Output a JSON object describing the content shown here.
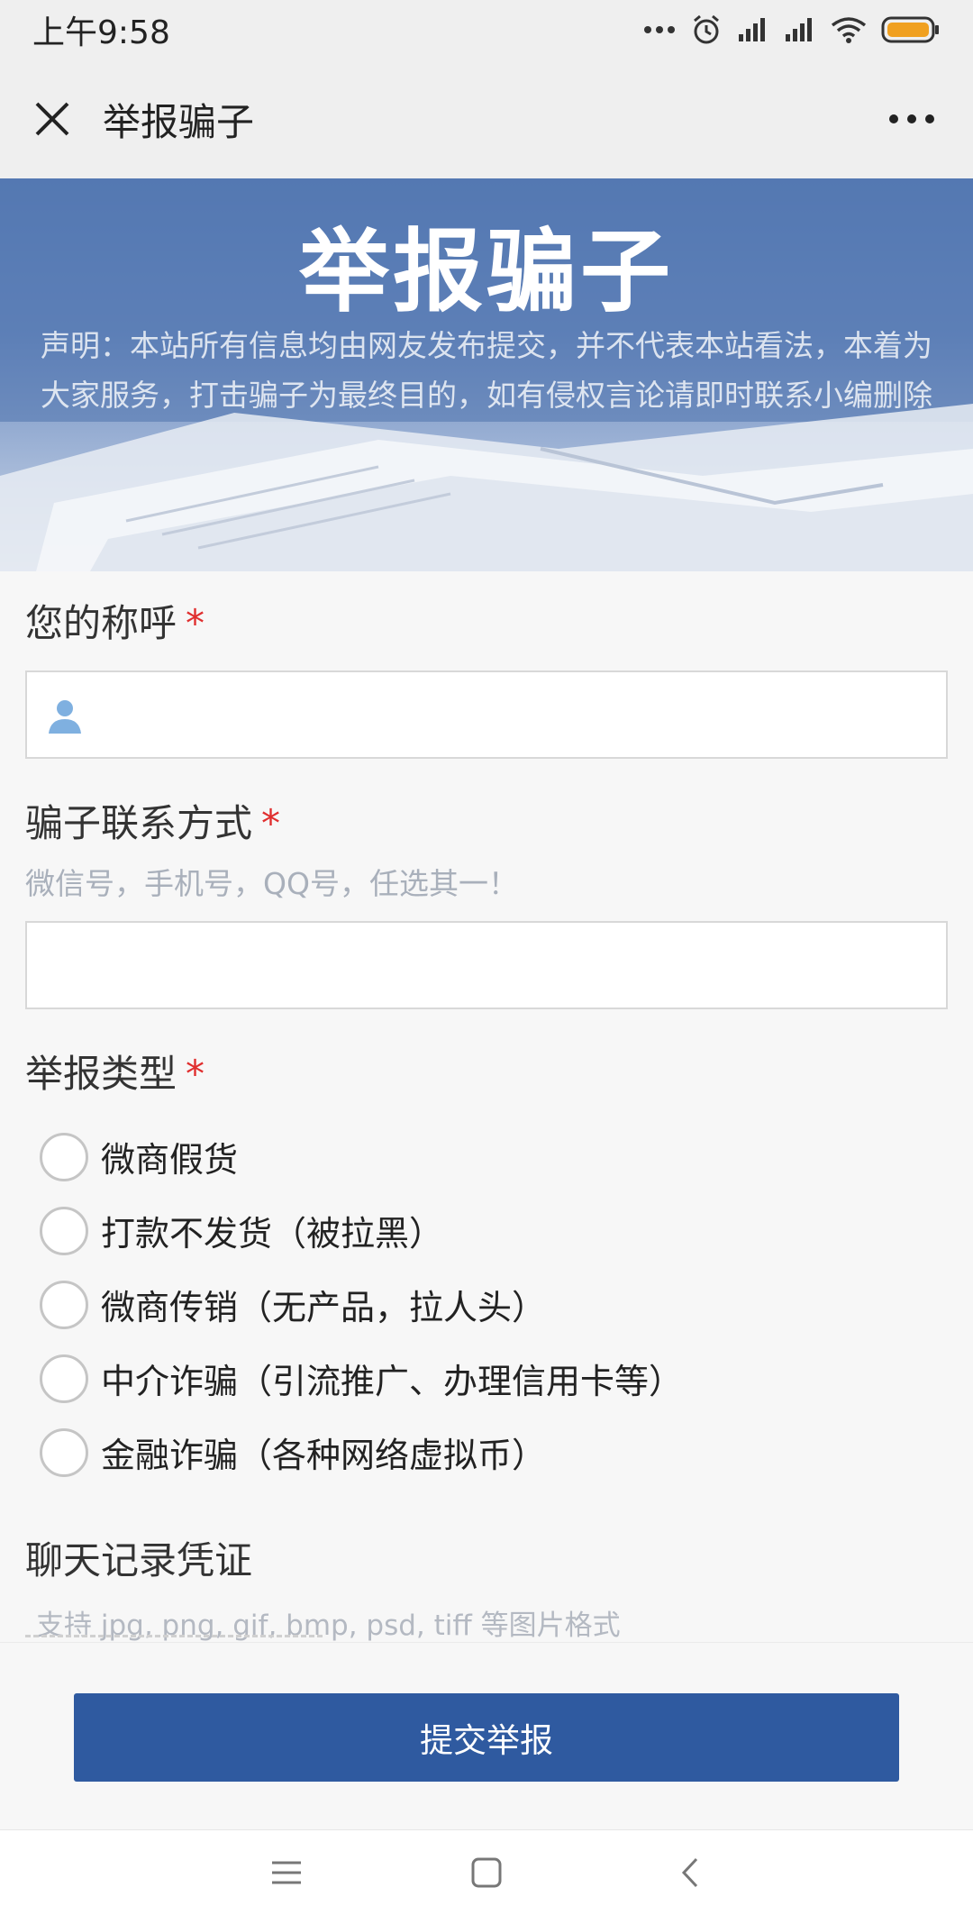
{
  "status_bar": {
    "time": "上午9:58",
    "icons": [
      "more-dots-icon",
      "alarm-icon",
      "signal-icon",
      "signal-icon",
      "wifi-icon",
      "battery-icon"
    ],
    "battery_color": "#f0a020"
  },
  "nav": {
    "title": "举报骗子",
    "close_icon": "close-icon",
    "more_icon": "more-icon"
  },
  "banner": {
    "title": "举报骗子",
    "notice": "声明：本站所有信息均由网友发布提交，并不代表本站看法，本着为大家服务，打击骗子为最终目的，如有侵权言论请即时联系小编删除"
  },
  "form": {
    "name_field": {
      "label": "您的称呼",
      "required": "*",
      "icon": "user-icon",
      "value": ""
    },
    "contact_field": {
      "label": "骗子联系方式",
      "required": "*",
      "hint": "微信号，手机号，QQ号，任选其一！",
      "value": ""
    },
    "type_field": {
      "label": "举报类型",
      "required": "*",
      "options": [
        "微商假货",
        "打款不发货（被拉黑）",
        "微商传销（无产品，拉人头）",
        "中介诈骗（引流推广、办理信用卡等）",
        "金融诈骗（各种网络虚拟币）"
      ]
    },
    "evidence_field": {
      "label": "聊天记录凭证",
      "hint": "支持 jpg, png, gif, bmp, psd, tiff 等图片格式"
    }
  },
  "submit": {
    "label": "提交举报",
    "color": "#2f5aa0"
  },
  "system_nav": [
    "menu-icon",
    "home-icon",
    "back-icon"
  ],
  "colors": {
    "accent": "#2f5aa0",
    "required": "#e02e2e",
    "hint": "#a9b0bb"
  }
}
